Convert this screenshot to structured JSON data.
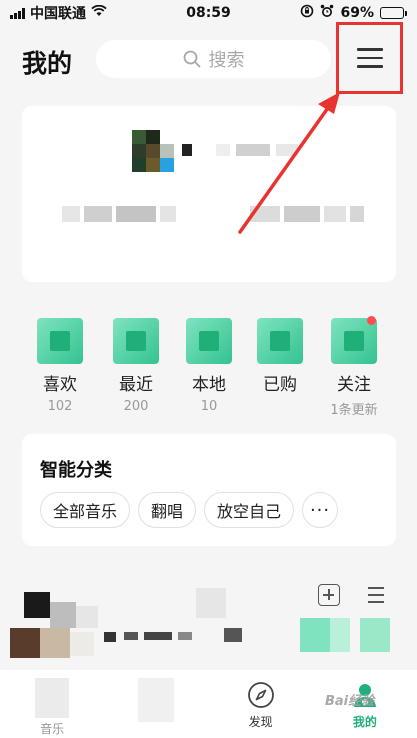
{
  "status_bar": {
    "carrier": "中国联通",
    "time": "08:59",
    "battery": "69%",
    "battery_level": 0.69
  },
  "header": {
    "title": "我的",
    "search_placeholder": "搜索"
  },
  "quick_entries": [
    {
      "label": "喜欢",
      "count": "102"
    },
    {
      "label": "最近",
      "count": "200"
    },
    {
      "label": "本地",
      "count": "10"
    },
    {
      "label": "已购",
      "count": ""
    },
    {
      "label": "关注",
      "count": "1条更新"
    }
  ],
  "smart_category": {
    "title": "智能分类",
    "chips": [
      "全部音乐",
      "翻唱",
      "放空自己",
      "···"
    ]
  },
  "tab_bar": {
    "tabs": [
      {
        "label": "音乐"
      },
      {
        "label": ""
      },
      {
        "label": "发现"
      },
      {
        "label": "我的"
      }
    ]
  },
  "watermark": "Bai经验",
  "colors": {
    "accent": "#1fb07a",
    "annotation": "#e8332e",
    "badge": "#ff4d4f"
  }
}
